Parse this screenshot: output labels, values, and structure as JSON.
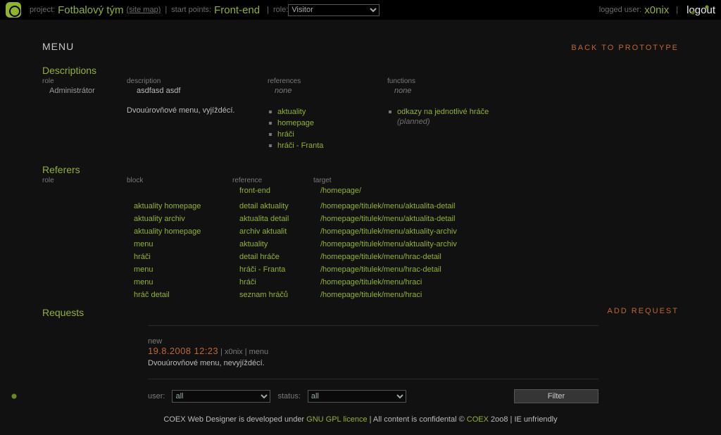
{
  "top": {
    "project_label": "project:",
    "project_name": "Fotbalový tým",
    "sitemap": "(site map)",
    "startpoints_label": "start points:",
    "startpoint": "Front-end",
    "role_label": "role:",
    "role_value": "Visitor",
    "logged_label": "logged user:",
    "logged_user": "x0nix",
    "logout": "logout"
  },
  "page": {
    "title": "MENU",
    "back": "BACK TO PROTOTYPE"
  },
  "descriptions": {
    "heading": "Descriptions",
    "headers": {
      "c0": "role",
      "c1": "description",
      "c2": "references",
      "c3": "functions"
    },
    "row1": {
      "role": "Administrátor",
      "description": "asdfasd asdf",
      "references": "none",
      "functions": "none"
    },
    "row2": {
      "description": "Dvouúrovňové menu, vyjíždécí.",
      "refs": [
        "aktuality",
        "homepage",
        "hráči",
        "hráči - Franta"
      ],
      "func": {
        "label": "odkazy na jednotlivé hráče",
        "status": "(planned)"
      }
    }
  },
  "referers": {
    "heading": "Referers",
    "headers": {
      "c0": "role",
      "c1": "block",
      "c2": "reference",
      "c3": "target"
    },
    "top_row": {
      "block": "",
      "reference": "front-end",
      "target": "/homepage/"
    },
    "rows": [
      {
        "block": "aktuality homepage",
        "reference": "detail aktuality",
        "target": "/homepage/titulek/menu/aktualita-detail"
      },
      {
        "block": "aktuality archiv",
        "reference": "aktualita detail",
        "target": "/homepage/titulek/menu/aktualita-detail"
      },
      {
        "block": "aktuality homepage",
        "reference": "archiv aktualit",
        "target": "/homepage/titulek/menu/aktuality-archiv"
      },
      {
        "block": "menu",
        "reference": "aktuality",
        "target": "/homepage/titulek/menu/aktuality-archiv"
      },
      {
        "block": "hráči",
        "reference": "detail hráče",
        "target": "/homepage/titulek/menu/hrac-detail"
      },
      {
        "block": "menu",
        "reference": "hráči - Franta",
        "target": "/homepage/titulek/menu/hrac-detail"
      },
      {
        "block": "menu",
        "reference": "hráči",
        "target": "/homepage/titulek/menu/hraci"
      },
      {
        "block": "hráč detail",
        "reference": "seznam hráčů",
        "target": "/homepage/titulek/menu/hraci"
      }
    ]
  },
  "requests": {
    "heading": "Requests",
    "add": "ADD REQUEST",
    "item": {
      "status": "new",
      "date": "19.8.2008 12:23",
      "user": "x0nix",
      "on": "menu",
      "text": "Dvouúrovňové menu, nevyjíždécí."
    },
    "filter": {
      "user_label": "user:",
      "user_value": "all",
      "status_label": "status:",
      "status_value": "all",
      "button": "Filter"
    }
  },
  "footer": {
    "t1": "COEX Web Designer is developed under ",
    "lic": "GNU GPL licence",
    "t2": " | All content is confidental © ",
    "coex": "COEX",
    "t3": " 2oo8 | IE unfriendly"
  }
}
